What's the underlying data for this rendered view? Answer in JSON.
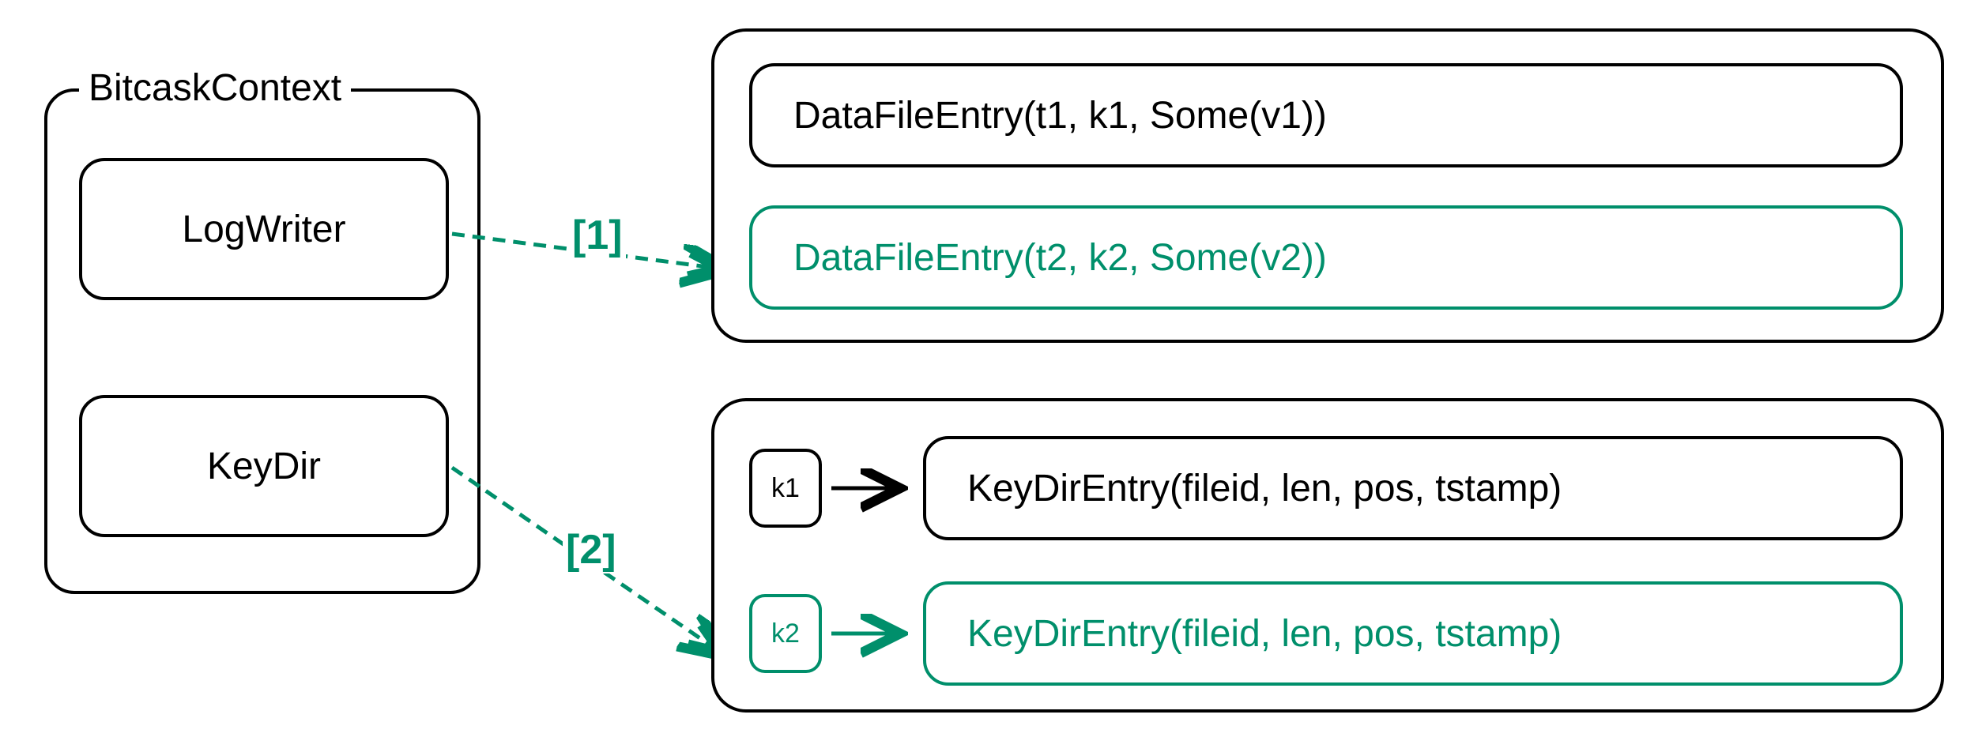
{
  "colors": {
    "accent": "#008F6B",
    "stroke": "#000000"
  },
  "context": {
    "title": "BitcaskContext",
    "items": [
      {
        "label": "LogWriter"
      },
      {
        "label": "KeyDir"
      }
    ]
  },
  "arrows": {
    "a1_label": "[1]",
    "a2_label": "[2]"
  },
  "datafile": {
    "entries": [
      {
        "text": "DataFileEntry(t1, k1, Some(v1))",
        "highlight": false
      },
      {
        "text": "DataFileEntry(t2, k2, Some(v2))",
        "highlight": true
      }
    ]
  },
  "keydir": {
    "entries": [
      {
        "key": "k1",
        "value": "KeyDirEntry(fileid, len, pos, tstamp)",
        "highlight": false
      },
      {
        "key": "k2",
        "value": "KeyDirEntry(fileid, len, pos, tstamp)",
        "highlight": true
      }
    ]
  }
}
